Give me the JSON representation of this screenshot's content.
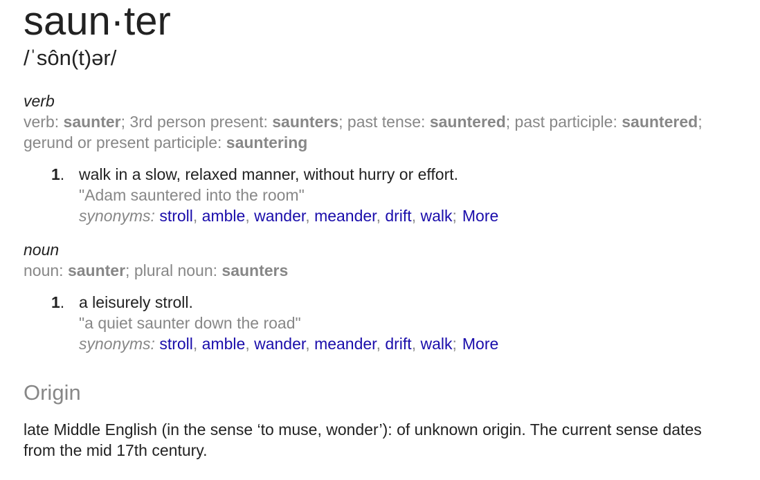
{
  "entry": {
    "headword": "saun·ter",
    "phonetic": "/ˈsôn(t)ər/"
  },
  "verb": {
    "pos_label": "verb",
    "forms": [
      {
        "label": "verb: ",
        "value": "saunter",
        "sep": "; "
      },
      {
        "label": "3rd person present: ",
        "value": "saunters",
        "sep": "; "
      },
      {
        "label": "past tense: ",
        "value": "sauntered",
        "sep": "; "
      },
      {
        "label": "past participle: ",
        "value": "sauntered",
        "sep": "; "
      },
      {
        "label": "gerund or present participle: ",
        "value": "sauntering",
        "sep": ""
      }
    ],
    "sense": {
      "number": "1",
      "definition": "walk in a slow, relaxed manner, without hurry or effort.",
      "example": "\"Adam sauntered into the room\"",
      "synonyms_label": "synonyms:",
      "synonyms": [
        "stroll",
        "amble",
        "wander",
        "meander",
        "drift",
        "walk"
      ],
      "more_label": "More"
    }
  },
  "noun": {
    "pos_label": "noun",
    "forms": [
      {
        "label": "noun: ",
        "value": "saunter",
        "sep": "; "
      },
      {
        "label": "plural noun: ",
        "value": "saunters",
        "sep": ""
      }
    ],
    "sense": {
      "number": "1",
      "definition": "a leisurely stroll.",
      "example": "\"a quiet saunter down the road\"",
      "synonyms_label": "synonyms:",
      "synonyms": [
        "stroll",
        "amble",
        "wander",
        "meander",
        "drift",
        "walk"
      ],
      "more_label": "More"
    }
  },
  "origin": {
    "title": "Origin",
    "text": "late Middle English (in the sense ‘to muse, wonder’): of unknown origin. The current sense dates from the mid 17th century."
  },
  "colors": {
    "text": "#222222",
    "muted": "#878787",
    "link": "#1a0dab"
  }
}
